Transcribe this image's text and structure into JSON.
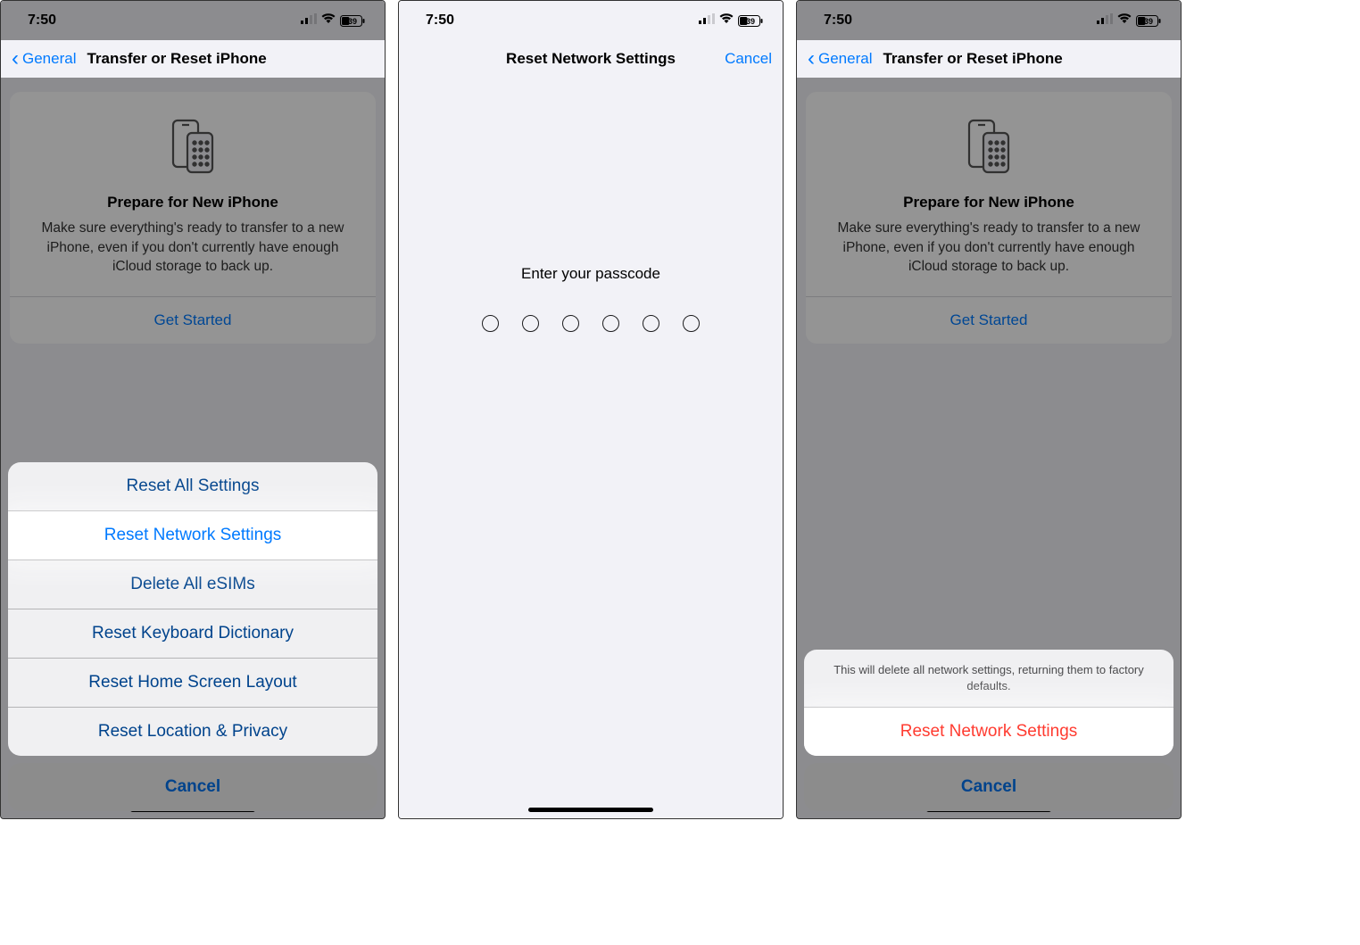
{
  "status": {
    "time": "7:50",
    "battery": "39"
  },
  "nav": {
    "back": "General",
    "title": "Transfer or Reset iPhone"
  },
  "prepare": {
    "title": "Prepare for New iPhone",
    "desc": "Make sure everything's ready to transfer to a new iPhone, even if you don't currently have enough iCloud storage to back up.",
    "getStarted": "Get Started"
  },
  "resetSheet": {
    "items": [
      "Reset All Settings",
      "Reset Network Settings",
      "Delete All eSIMs",
      "Reset Keyboard Dictionary",
      "Reset Home Screen Layout",
      "Reset Location & Privacy"
    ],
    "cancel": "Cancel"
  },
  "passcode": {
    "title": "Reset Network Settings",
    "cancel": "Cancel",
    "prompt": "Enter your passcode"
  },
  "confirmSheet": {
    "message": "This will delete all network settings, returning them to factory defaults.",
    "action": "Reset Network Settings",
    "cancel": "Cancel"
  }
}
